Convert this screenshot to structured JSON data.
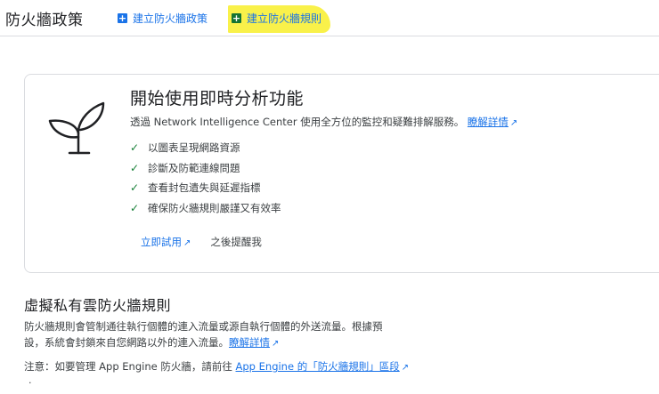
{
  "header": {
    "title": "防火牆政策",
    "create_policy_label": "建立防火牆政策",
    "create_rule_label": "建立防火牆規則"
  },
  "card": {
    "title": "開始使用即時分析功能",
    "description_text": "透過 Network Intelligence Center 使用全方位的監控和疑難排解服務。",
    "learn_more_label": "瞭解詳情",
    "features": [
      "以圖表呈現網路資源",
      "診斷及防範連線問題",
      "查看封包遺失與延遲指標",
      "確保防火牆規則嚴謹又有效率"
    ],
    "try_now_label": "立即試用",
    "remind_later_label": "之後提醒我"
  },
  "section": {
    "title": "虛擬私有雲防火牆規則",
    "body_text": "防火牆規則會管制通往執行個體的連入流量或源自執行個體的外送流量。根據預設，系統會封鎖來自您網路以外的連入流量。",
    "learn_more_label": "瞭解詳情",
    "note_prefix": "注意：如要管理 App Engine 防火牆，請前往",
    "note_link_label": "App Engine 的「防火牆規則」區段"
  },
  "colors": {
    "accent": "#1a73e8",
    "check": "#188038",
    "highlight": "#f9f14a",
    "rule_plus": "#137333"
  }
}
